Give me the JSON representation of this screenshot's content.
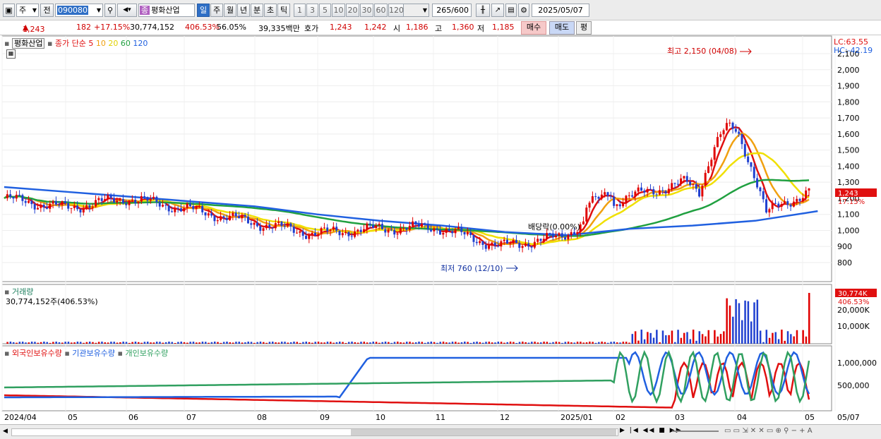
{
  "toolbar": {
    "market": "주",
    "prev_label": "전",
    "code": "090080",
    "stock_name": "평화산업",
    "badge": "종",
    "periods": [
      "일",
      "주",
      "월",
      "년",
      "분",
      "초",
      "틱"
    ],
    "intervals": [
      "1",
      "3",
      "5",
      "10",
      "20",
      "30",
      "60",
      "120"
    ],
    "count": "265",
    "count_total": "/600",
    "date": "2025/05/07"
  },
  "quote": {
    "price": "1,243",
    "change": "182",
    "change_pct": "+17.15%",
    "volume": "30,774,152",
    "volume_ratio": "406.53%",
    "turnover": "56.05%",
    "amount": "39,335백만",
    "hoga_label": "호가",
    "ask": "1,243",
    "bid": "1,242",
    "open_label": "시",
    "open": "1,186",
    "high_label": "고",
    "high": "1,360",
    "low_label": "저",
    "low": "1,185",
    "buy_label": "매수",
    "sell_label": "매도",
    "extra_label": "평"
  },
  "price_panel": {
    "name": "평화산업",
    "legend_title": "종가 단순",
    "ma_periods": [
      "5",
      "10",
      "20",
      "60",
      "120"
    ],
    "lc": "LC:63.55",
    "hc": "HC:-42.19",
    "max_note": "최고 2,150 (04/08)",
    "min_note": "최저 760 (12/10)",
    "div_note": "배당락(0.00%)",
    "last_price": "1,243",
    "last_pct": "17.15%",
    "y_ticks": [
      "2,100",
      "2,000",
      "1,900",
      "1,800",
      "1,700",
      "1,600",
      "1,500",
      "1,400",
      "1,300",
      "1,200",
      "1,100",
      "1,000",
      "900",
      "800"
    ]
  },
  "volume_panel": {
    "title": "거래량",
    "value": "30,774,152주(406.53%)",
    "last": "30,774K",
    "last_pct": "406.53%",
    "y_ticks": [
      "20,000K",
      "10,000K"
    ]
  },
  "holding_panel": {
    "labels": [
      "외국인보유수량",
      "기관보유수량",
      "개인보유수량"
    ],
    "y_ticks": [
      "1,000,000",
      "500,000"
    ]
  },
  "x_axis": [
    "2024/04",
    "05",
    "06",
    "07",
    "08",
    "09",
    "10",
    "11",
    "12",
    "2025/01",
    "02",
    "03",
    "04",
    "05",
    "05/07"
  ],
  "colors": {
    "ma5": "#e01010",
    "ma10": "#f0a010",
    "ma20": "#f0e000",
    "ma60": "#20a040",
    "ma120": "#2060e0",
    "up": "#e00000",
    "down": "#2040d0",
    "foreign": "#e01010",
    "institution": "#2060e0",
    "individual": "#30a060"
  },
  "chart_data": {
    "type": "line",
    "title": "평화산업",
    "x": [
      "2024/04",
      "05",
      "06",
      "07",
      "08",
      "09",
      "10",
      "11",
      "12",
      "2025/01",
      "02",
      "03",
      "04",
      "05"
    ],
    "series": [
      {
        "name": "종가",
        "values": [
          1200,
          1140,
          1200,
          1130,
          1050,
          980,
          1010,
          1020,
          900,
          960,
          1200,
          1300,
          1050,
          1243
        ]
      },
      {
        "name": "120",
        "values": [
          1270,
          1240,
          1210,
          1180,
          1150,
          1100,
          1060,
          1030,
          990,
          970,
          1010,
          1030,
          1060,
          1120
        ]
      }
    ],
    "ylim": [
      700,
      2150
    ]
  }
}
